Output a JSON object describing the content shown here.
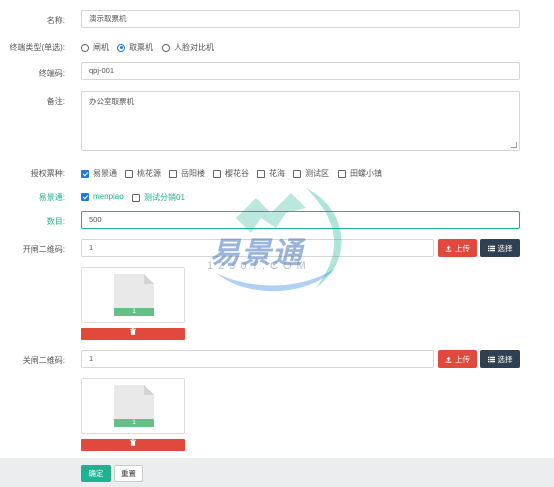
{
  "form": {
    "name": {
      "label": "名称:",
      "value": "演示取票机"
    },
    "terminal_type": {
      "label": "终端类型(单选):",
      "options": [
        {
          "label": "闸机",
          "selected": false
        },
        {
          "label": "取票机",
          "selected": true
        },
        {
          "label": "人脸对比机",
          "selected": false
        }
      ]
    },
    "terminal_code": {
      "label": "终端码:",
      "value": "qpj-001"
    },
    "remark": {
      "label": "备注:",
      "value": "办公室取票机"
    },
    "ticket_types": {
      "label": "授权票种:",
      "options": [
        {
          "label": "易景通",
          "checked": true
        },
        {
          "label": "桃花源",
          "checked": false
        },
        {
          "label": "岳阳楼",
          "checked": false
        },
        {
          "label": "樱花谷",
          "checked": false
        },
        {
          "label": "花海",
          "checked": false
        },
        {
          "label": "测试区",
          "checked": false
        },
        {
          "label": "田螺小镇",
          "checked": false
        }
      ]
    },
    "yijingtong": {
      "label": "易景通:",
      "options": [
        {
          "label": "menpiao",
          "checked": true
        },
        {
          "label": "测试分销01",
          "checked": false
        }
      ]
    },
    "count": {
      "label": "数目:",
      "value": "500"
    },
    "open_qr": {
      "label": "开闸二维码:",
      "value": "1",
      "thumb_badge": "1"
    },
    "close_qr": {
      "label": "关闸二维码:",
      "value": "1",
      "thumb_badge": "1"
    },
    "upload_label": "上传",
    "select_label": "选择"
  },
  "footer": {
    "submit_label": "确定",
    "reset_label": "重置"
  },
  "watermark": {
    "title": "易景通",
    "subtitle": "1230T.COM"
  },
  "colors": {
    "accent": "#1ab394",
    "danger": "#e2493d",
    "dark": "#2f4050",
    "checked": "#1e7be0"
  }
}
